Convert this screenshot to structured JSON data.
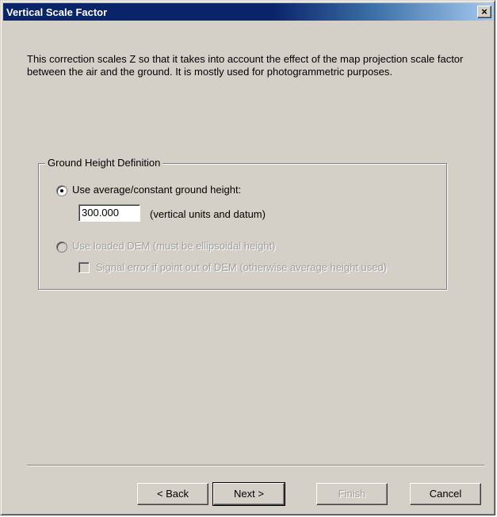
{
  "window": {
    "title": "Vertical Scale Factor",
    "close_symbol": "✕"
  },
  "description": "This correction scales Z so that it takes into account the effect of the map projection scale factor between the air and the ground.  It is mostly used for photogrammetric purposes.",
  "group": {
    "legend": "Ground Height Definition",
    "option_average": {
      "label": "Use average/constant ground height:",
      "selected": true,
      "enabled": true
    },
    "height_input": {
      "value": "300.000",
      "units_label": "(vertical units and datum)"
    },
    "option_dem": {
      "label": "Use loaded DEM (must be ellipsoidal height)",
      "selected": false,
      "enabled": false
    },
    "signal_error": {
      "label": "Signal error if point out of DEM (otherwise average height used)",
      "checked": false,
      "enabled": false
    }
  },
  "buttons": {
    "back": "< Back",
    "next": "Next >",
    "finish": "Finish",
    "cancel": "Cancel"
  },
  "colors": {
    "dialog_face": "#d4d0c8",
    "titlebar_active": "#0a246a",
    "disabled_text": "#a0a0a0"
  }
}
